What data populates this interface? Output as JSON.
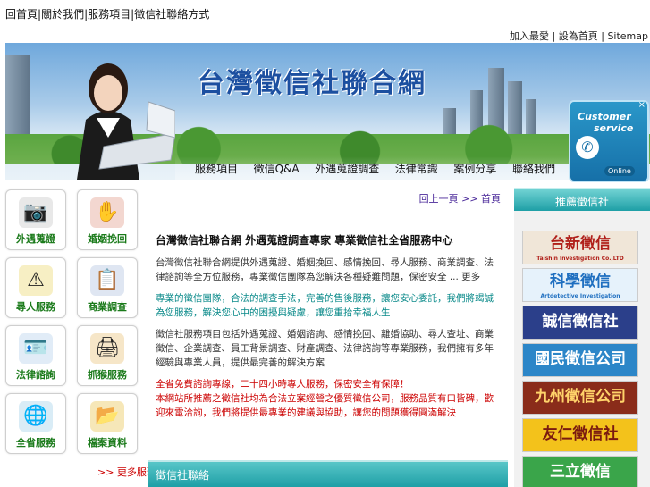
{
  "top_links": [
    "回首頁",
    "關於我們",
    "服務項目",
    "徵信社聯絡方式"
  ],
  "top_sep": "|",
  "utility": {
    "link1": "加入最愛",
    "link2": "設為首頁",
    "sitemap": "Sitemap",
    "sep": "|"
  },
  "banner": {
    "title": "台灣徵信社聯合網",
    "nav": [
      "服務項目",
      "徵信Q&A",
      "外遇蒐證調查",
      "法律常識",
      "案例分享",
      "聯絡我們"
    ]
  },
  "customer_service": {
    "line1": "Customer",
    "line2": "service",
    "status": "Online",
    "close": "×",
    "phone_glyph": "✆"
  },
  "services": [
    {
      "label": "外遇蒐證",
      "icon": "camera-icon",
      "glyph": "📷",
      "color": "#e8e8e8"
    },
    {
      "label": "婚姻挽回",
      "icon": "hand-stop-icon",
      "glyph": "✋",
      "color": "#f3d7d0"
    },
    {
      "label": "尋人服務",
      "icon": "warning-icon",
      "glyph": "⚠",
      "color": "#f7efc4"
    },
    {
      "label": "商業調查",
      "icon": "document-icon",
      "glyph": "📋",
      "color": "#dfe6f2"
    },
    {
      "label": "法律諮詢",
      "icon": "id-card-icon",
      "glyph": "🪪",
      "color": "#e1ecf7"
    },
    {
      "label": "抓猴服務",
      "icon": "printer-icon",
      "glyph": "🖨",
      "color": "#f6e6c8"
    },
    {
      "label": "全省服務",
      "icon": "globe-icon",
      "glyph": "🌐",
      "color": "#d9ecf6"
    },
    {
      "label": "檔案資料",
      "icon": "folder-icon",
      "glyph": "📂",
      "color": "#f6e7b8"
    }
  ],
  "more_left": ">> 更多服務",
  "breadcrumb": "回上一頁 >> 首頁",
  "article": {
    "title": "台灣徵信社聯合網 外遇蒐證調查專家 專業徵信社全省服務中心",
    "p1": "台灣徵信社聯合網提供外遇蒐證、婚姻挽回、感情挽回、尋人服務、商業調查、法律諮詢等全方位服務，專業徵信團隊為您解決各種疑難問題，保密安全 ... 更多",
    "p2": "專業的徵信團隊，合法的調查手法，完善的售後服務，讓您安心委託，我們將竭誠為您服務，解決您心中的困擾與疑慮，讓您重拾幸福人生",
    "p3": "徵信社服務項目包括外遇蒐證、婚姻諮詢、感情挽回、離婚協助、尋人查址、商業徵信、企業調查、員工背景調查、財產調查、法律諮詢等專業服務，我們擁有多年經驗與專業人員，提供最完善的解決方案",
    "p4": "全省免費諮詢專線，二十四小時專人服務，保密安全有保障！",
    "p5": "本網站所推薦之徵信社均為合法立案經營之優質徵信公司，服務品質有口皆碑，歡迎來電洽詢，我們將提供最專業的建議與協助，讓您的問題獲得圓滿解決"
  },
  "section_bar": "徵信社聯絡",
  "right": {
    "header": "推薦徵信社",
    "logos": [
      {
        "name": "台新徵信",
        "sub": "Taishin Investigation Co.,LTD",
        "bg": "#f0e6d8",
        "fg": "#b0201a"
      },
      {
        "name": "科學徵信",
        "sub": "Artdetective Investigation",
        "bg": "#e6f2fb",
        "fg": "#1f6fc0"
      },
      {
        "name": "誠信徵信社",
        "sub": "",
        "bg": "#2b3f8a",
        "fg": "#ffffff"
      },
      {
        "name": "國民徵信公司",
        "sub": "",
        "bg": "#2c86c8",
        "fg": "#ffffff"
      },
      {
        "name": "九州徵信公司",
        "sub": "",
        "bg": "#8a2c1a",
        "fg": "#ffd36a"
      },
      {
        "name": "友仁徵信社",
        "sub": "",
        "bg": "#f3c21b",
        "fg": "#7a1a10"
      },
      {
        "name": "三立徵信",
        "sub": "",
        "bg": "#3aa54a",
        "fg": "#ffffff"
      }
    ]
  }
}
